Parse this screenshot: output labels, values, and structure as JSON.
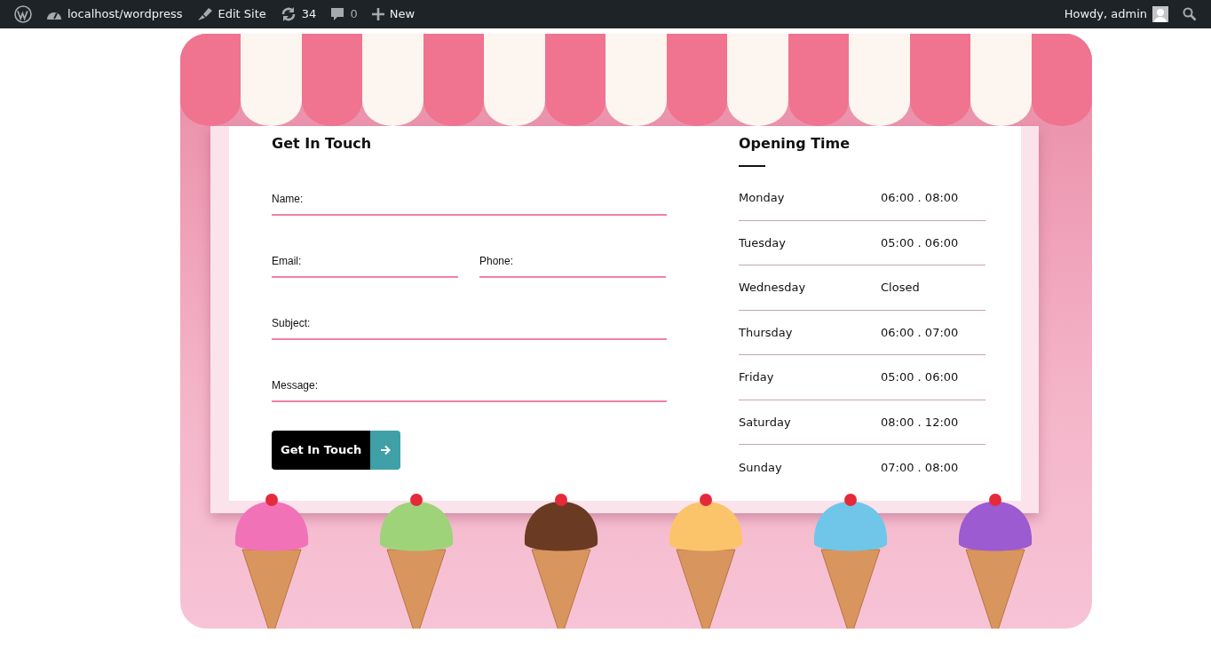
{
  "admin_bar": {
    "site": "localhost/wordpress",
    "edit": "Edit Site",
    "updates": "34",
    "comments": "0",
    "new": "New",
    "greeting": "Howdy, admin"
  },
  "contact": {
    "title": "Get In Touch",
    "fields": [
      {
        "kind": "full",
        "placeholder": "Name:"
      },
      {
        "kind": "half",
        "placeholder": "Email:"
      },
      {
        "kind": "half",
        "placeholder": "Phone:"
      },
      {
        "kind": "full",
        "placeholder": "Subject:"
      },
      {
        "kind": "full",
        "placeholder": "Message:"
      }
    ],
    "button": "Get In Touch"
  },
  "hours": {
    "title": "Opening Time",
    "rows": [
      {
        "day": "Monday",
        "time": "06:00 . 08:00"
      },
      {
        "day": "Tuesday",
        "time": "05:00 . 06:00"
      },
      {
        "day": "Wednesday",
        "time": "Closed"
      },
      {
        "day": "Thursday",
        "time": "06:00 . 07:00"
      },
      {
        "day": "Friday",
        "time": "05:00 . 06:00"
      },
      {
        "day": "Saturday",
        "time": "08:00 . 12:00"
      },
      {
        "day": "Sunday",
        "time": "07:00 . 08:00"
      }
    ]
  },
  "cones": [
    {
      "color": "#f272b8"
    },
    {
      "color": "#9fd37a"
    },
    {
      "color": "#6b3a22"
    },
    {
      "color": "#fbc46a"
    },
    {
      "color": "#6fc6e8"
    },
    {
      "color": "#9c5bd0"
    }
  ]
}
